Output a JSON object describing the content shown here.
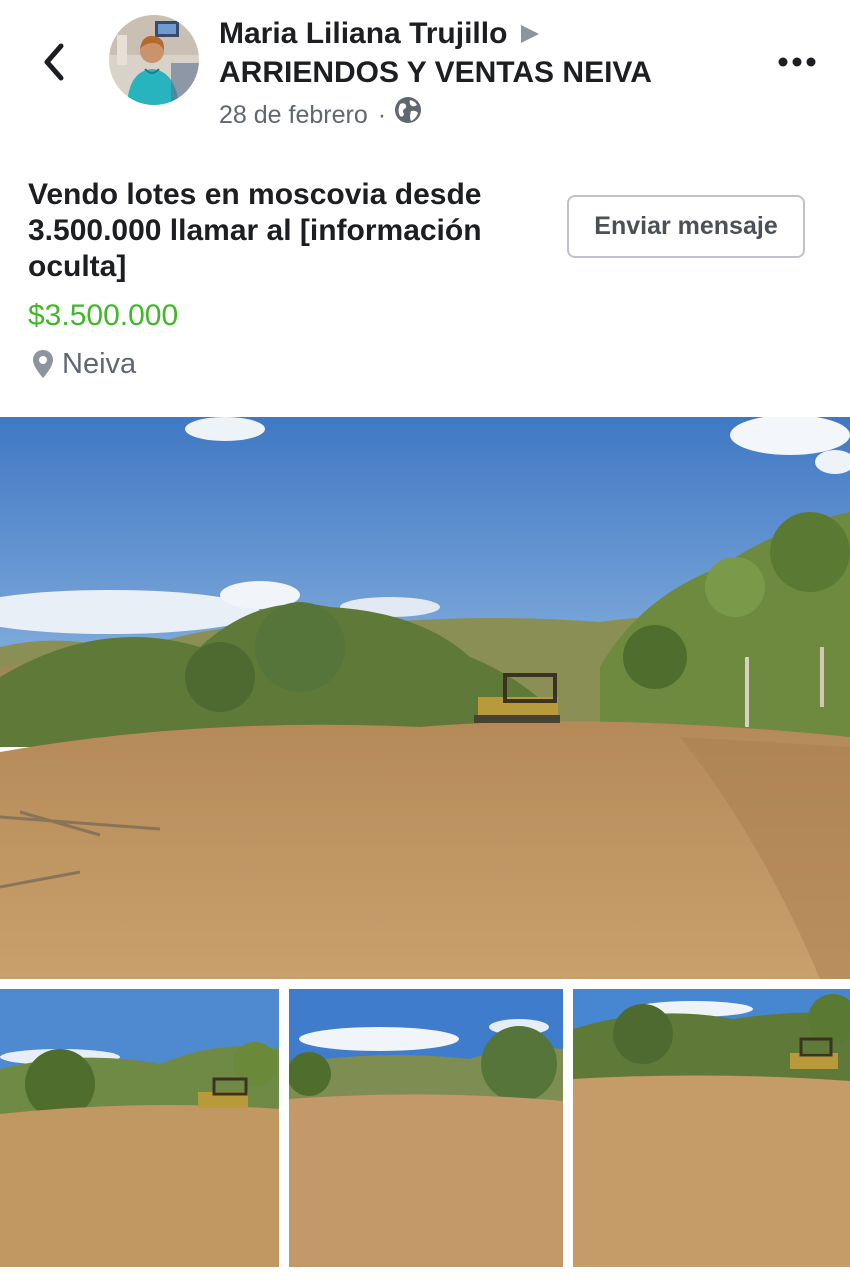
{
  "post": {
    "author": "Maria Liliana Trujillo",
    "group": "ARRIENDOS Y VENTAS NEIVA",
    "date": "28 de febrero",
    "separator": "·"
  },
  "listing": {
    "title": "Vendo lotes en moscovia desde 3.500.000 llamar al [información oculta]",
    "price": "$3.500.000",
    "location": "Neiva",
    "message_button": "Enviar mensaje"
  },
  "icons": {
    "back": "chevron-left-icon",
    "forward": "play-arrow-icon",
    "privacy": "globe-icon",
    "more": "more-horizontal-icon",
    "location": "map-pin-icon"
  },
  "colors": {
    "price": "#42b72a",
    "secondary_text": "#606770",
    "button_border": "#bec3c9"
  },
  "photos": {
    "main": "cleared-lot-with-bulldozer-photo",
    "thumbnails": [
      "lot-thumbnail-1",
      "lot-thumbnail-2",
      "lot-thumbnail-3"
    ]
  }
}
